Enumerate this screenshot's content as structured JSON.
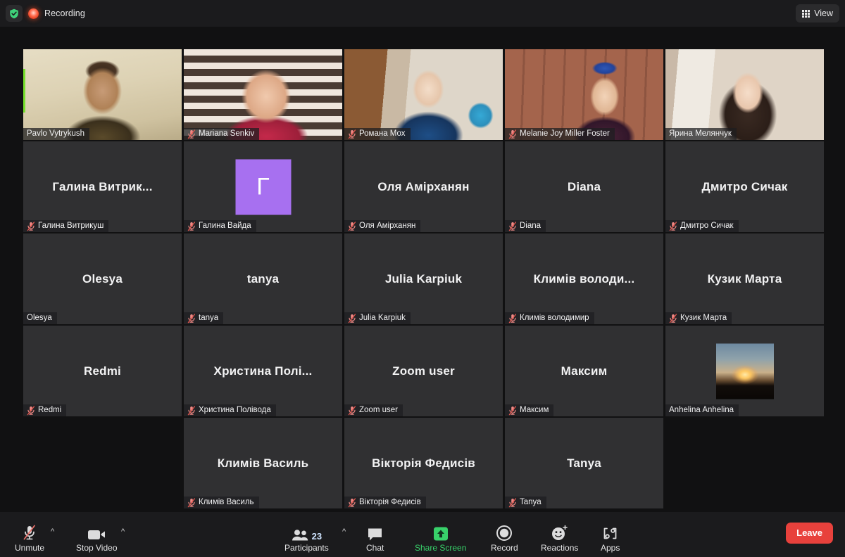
{
  "topbar": {
    "shield_icon": "shield-check-icon",
    "recording_icon": "recording-dot-icon",
    "recording_label": "Recording",
    "view_icon": "grid-view-icon",
    "view_label": "View"
  },
  "gallery": {
    "rows": [
      [
        {
          "name": "Pavlo Vytrykush",
          "display": "",
          "muted": false,
          "speaking": true,
          "media": "video",
          "video_class": "v-pavlo"
        },
        {
          "name": "Mariana Senkiv",
          "display": "",
          "muted": true,
          "speaking": false,
          "media": "video",
          "video_class": "v-mariana"
        },
        {
          "name": "Романа Мох",
          "display": "",
          "muted": true,
          "speaking": false,
          "media": "video",
          "video_class": "v-romana"
        },
        {
          "name": "Melanie Joy Miller Foster",
          "display": "",
          "muted": true,
          "speaking": false,
          "media": "video",
          "video_class": "v-melanie"
        },
        {
          "name": "Ярина Мелянчук",
          "display": "",
          "muted": false,
          "speaking": false,
          "media": "video",
          "video_class": "v-yaryna"
        }
      ],
      [
        {
          "name": "Галина Витрикуш",
          "display": "Галина  Витрик...",
          "muted": true,
          "speaking": false,
          "media": "name"
        },
        {
          "name": "Галина Вайда",
          "display": "",
          "muted": true,
          "speaking": false,
          "media": "avatar",
          "avatar_initial": "Г",
          "avatar_color": "#a770f0"
        },
        {
          "name": "Оля Амірханян",
          "display": "Оля Амірханян",
          "muted": true,
          "speaking": false,
          "media": "name"
        },
        {
          "name": "Diana",
          "display": "Diana",
          "muted": true,
          "speaking": false,
          "media": "name"
        },
        {
          "name": "Дмитро Сичак",
          "display": "Дмитро Сичак",
          "muted": true,
          "speaking": false,
          "media": "name"
        }
      ],
      [
        {
          "name": "Olesya",
          "display": "Olesya",
          "muted": false,
          "speaking": false,
          "media": "name"
        },
        {
          "name": "tanya",
          "display": "tanya",
          "muted": true,
          "speaking": false,
          "media": "name"
        },
        {
          "name": "Julia Karpiuk",
          "display": "Julia Karpiuk",
          "muted": true,
          "speaking": false,
          "media": "name"
        },
        {
          "name": "Климів володимир",
          "display": "Климів володи...",
          "muted": true,
          "speaking": false,
          "media": "name"
        },
        {
          "name": "Кузик Марта",
          "display": "Кузик Марта",
          "muted": true,
          "speaking": false,
          "media": "name"
        }
      ],
      [
        {
          "name": "Redmi",
          "display": "Redmi",
          "muted": true,
          "speaking": false,
          "media": "name"
        },
        {
          "name": "Христина Полівода",
          "display": "Христина  Полі...",
          "muted": true,
          "speaking": false,
          "media": "name"
        },
        {
          "name": "Zoom user",
          "display": "Zoom user",
          "muted": true,
          "speaking": false,
          "media": "name"
        },
        {
          "name": "Максим",
          "display": "Максим",
          "muted": true,
          "speaking": false,
          "media": "name"
        },
        {
          "name": "Anhelina Anhelina",
          "display": "",
          "muted": false,
          "speaking": false,
          "media": "photo"
        }
      ],
      [
        {
          "name": "",
          "display": "",
          "muted": false,
          "speaking": false,
          "media": "empty"
        },
        {
          "name": "Климів Василь",
          "display": "Климів Василь",
          "muted": true,
          "speaking": false,
          "media": "name"
        },
        {
          "name": "Вікторія Федисів",
          "display": "Вікторія Федисів",
          "muted": true,
          "speaking": false,
          "media": "name"
        },
        {
          "name": "Tanya",
          "display": "Tanya",
          "muted": true,
          "speaking": false,
          "media": "name"
        },
        {
          "name": "",
          "display": "",
          "muted": false,
          "speaking": false,
          "media": "empty"
        }
      ]
    ]
  },
  "toolbar": {
    "mute": {
      "label": "Unmute",
      "icon": "microphone-muted-icon"
    },
    "mute_chevron": "chevron-up-icon",
    "video": {
      "label": "Stop Video",
      "icon": "video-camera-icon"
    },
    "video_chevron": "chevron-up-icon",
    "participants": {
      "label": "Participants",
      "icon": "participants-icon",
      "count": "23"
    },
    "participants_chevron": "chevron-up-icon",
    "chat": {
      "label": "Chat",
      "icon": "chat-bubble-icon"
    },
    "share": {
      "label": "Share Screen",
      "icon": "share-screen-up-arrow-icon",
      "color": "#38d16a"
    },
    "record": {
      "label": "Record",
      "icon": "record-circle-icon"
    },
    "reactions": {
      "label": "Reactions",
      "icon": "reactions-smiley-plus-icon"
    },
    "apps": {
      "label": "Apps",
      "icon": "apps-bracket-icon"
    },
    "leave": {
      "label": "Leave",
      "color": "#e8413c"
    }
  }
}
